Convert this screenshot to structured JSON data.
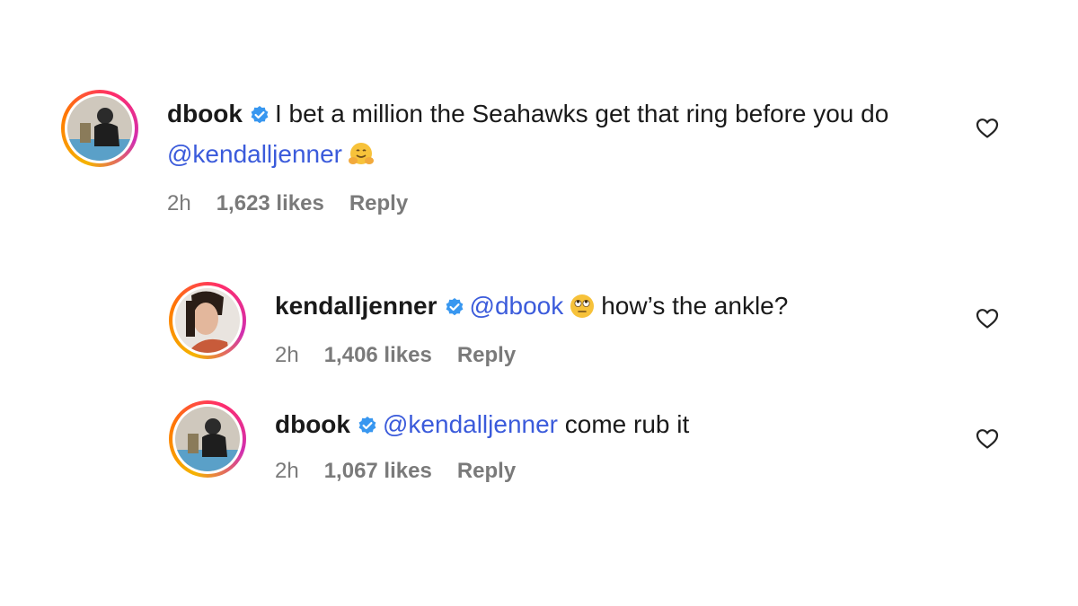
{
  "comments": [
    {
      "username": "dbook",
      "text_before": "I bet a million the Seahawks get that ring before you do",
      "mention": "@kendalljenner",
      "text_after": "",
      "emoji": "hugging-face-emoji",
      "time": "2h",
      "likes": "1,623 likes",
      "reply_label": "Reply"
    },
    {
      "username": "kendalljenner",
      "mention": "@dbook",
      "emoji": "eye-roll-emoji",
      "text_after": "how’s the ankle?",
      "time": "2h",
      "likes": "1,406 likes",
      "reply_label": "Reply"
    },
    {
      "username": "dbook",
      "mention": "@kendalljenner",
      "text_after": "come rub it",
      "time": "2h",
      "likes": "1,067 likes",
      "reply_label": "Reply"
    }
  ],
  "colors": {
    "mention": "#3b5bdb",
    "verified": "#3897f0",
    "meta": "#7a7a7a"
  },
  "icons": [
    "verified-badge-icon",
    "heart-icon"
  ]
}
